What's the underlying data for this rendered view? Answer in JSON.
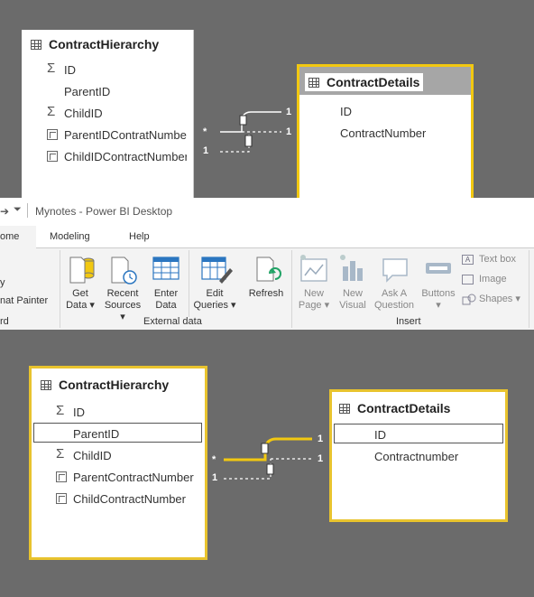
{
  "top_diagram": {
    "hierarchy_table": {
      "title": "ContractHierarchy",
      "fields": [
        "ID",
        "ParentID",
        "ChildID",
        "ParentIDContratNumber",
        "ChildIDContractNumber"
      ]
    },
    "details_table": {
      "title": "ContractDetails",
      "fields": [
        "ID",
        "ContractNumber"
      ]
    },
    "relationship_labels": {
      "many": "*",
      "one_a": "1",
      "one_b": "1",
      "one_c": "1"
    }
  },
  "window": {
    "title": "Mynotes - Power BI Desktop",
    "tabs": [
      "ome",
      "Modeling",
      "Help"
    ],
    "left_partial": {
      "item1": "y",
      "item2": "nat Painter",
      "group": "rd"
    },
    "buttons": {
      "get_data": [
        "Get",
        "Data ▾"
      ],
      "recent_sources": [
        "Recent",
        "Sources ▾"
      ],
      "enter_data": [
        "Enter",
        "Data"
      ],
      "edit_queries": [
        "Edit",
        "Queries ▾"
      ],
      "refresh": [
        "Refresh"
      ],
      "new_page": [
        "New",
        "Page ▾"
      ],
      "new_visual": [
        "New",
        "Visual"
      ],
      "ask_question": [
        "Ask A",
        "Question"
      ],
      "buttons": [
        "Buttons",
        "▾"
      ],
      "text_box": "Text box",
      "image": "Image",
      "shapes": "Shapes ▾"
    },
    "groups": {
      "external_data": "External data",
      "insert": "Insert"
    },
    "colors": {
      "accent": "#f2c811",
      "ribbon_bg": "#f3f3f3",
      "canvas_bg": "#6b6b6b"
    }
  },
  "bottom_diagram": {
    "hierarchy_table": {
      "title": "ContractHierarchy",
      "fields": [
        "ID",
        "ParentID",
        "ChildID",
        "ParentContractNumber",
        "ChildContractNumber"
      ]
    },
    "details_table": {
      "title": "ContractDetails",
      "fields": [
        "ID",
        "Contractnumber"
      ]
    },
    "relationship_labels": {
      "many": "*",
      "one_a": "1",
      "one_b": "1",
      "one_c": "1"
    }
  }
}
